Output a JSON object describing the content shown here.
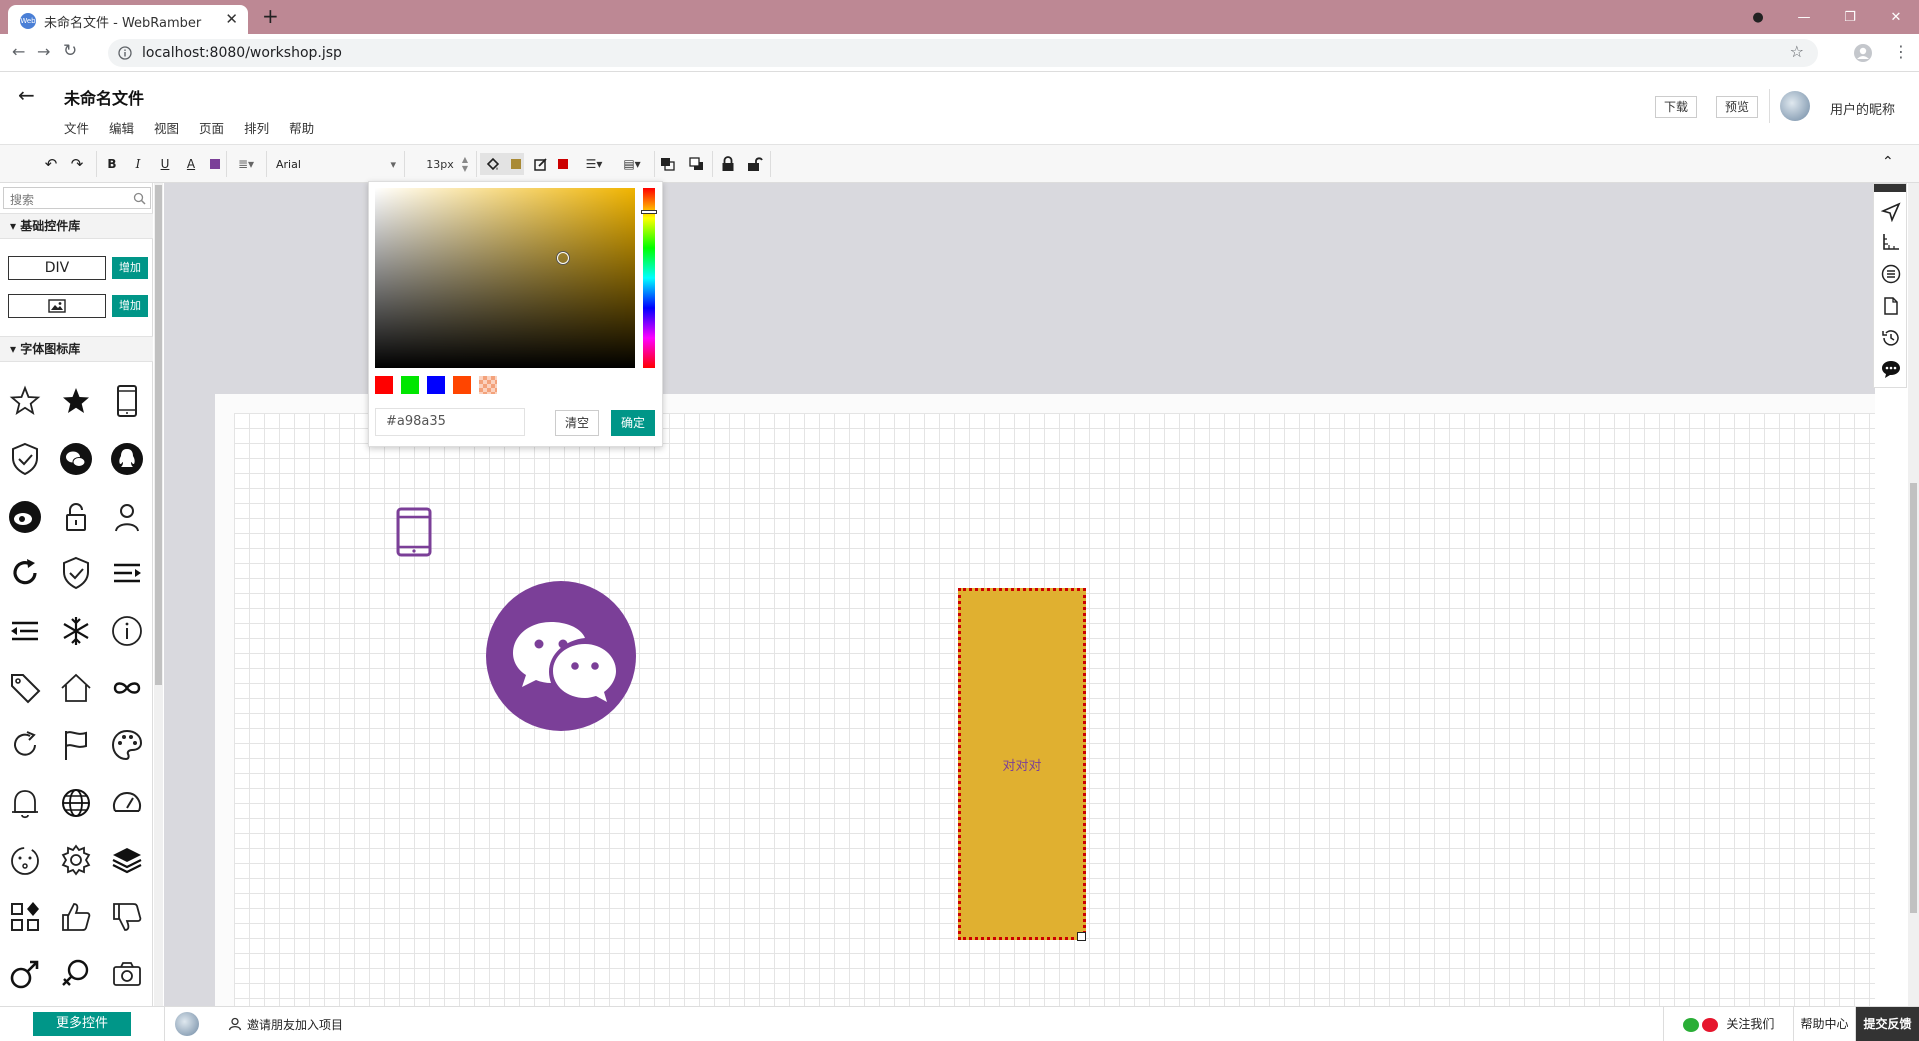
{
  "browser": {
    "tab_title": "未命名文件 - WebRamber",
    "favicon_text": "Web",
    "url": "localhost:8080/workshop.jsp"
  },
  "header": {
    "doc_title": "未命名文件",
    "menus": [
      "文件",
      "编辑",
      "视图",
      "页面",
      "排列",
      "帮助"
    ],
    "download_label": "下载",
    "preview_label": "预览",
    "nickname": "用户的昵称"
  },
  "toolbar": {
    "bold": "B",
    "italic": "I",
    "underline": "U",
    "font_color_glyph": "A",
    "font_family": "Arial",
    "font_size": "13px",
    "font_color": "#7b3f98",
    "fill_color": "#a98a35",
    "stroke_color": "#cc0000"
  },
  "sidebar": {
    "search_placeholder": "搜索",
    "basic_section": "基础控件库",
    "basic_items": [
      {
        "label": "DIV",
        "add": "增加"
      },
      {
        "label": "",
        "icon": "image-icon",
        "add": "增加"
      }
    ],
    "icon_section": "字体图标库",
    "icons": [
      "star-outline-icon",
      "star-filled-icon",
      "tablet-icon",
      "shield-check-icon",
      "wechat-icon",
      "qq-icon",
      "weibo-icon",
      "unlock-icon",
      "user-icon",
      "refresh-icon",
      "shield-check-icon",
      "indent-icon",
      "outdent-icon",
      "snowflake-icon",
      "info-icon",
      "tag-icon",
      "home-icon",
      "infinity-icon",
      "refresh-icon",
      "flag-icon",
      "palette-icon",
      "bell-icon",
      "globe-icon",
      "dashboard-icon",
      "face-icon",
      "gear-icon",
      "layers-icon",
      "apps-icon",
      "thumbs-up-icon",
      "thumbs-down-icon",
      "male-icon",
      "female-icon",
      "camera-icon"
    ]
  },
  "color_picker": {
    "hex_value": "#a98a35",
    "clear_label": "清空",
    "confirm_label": "确定",
    "swatches": [
      "#ff0000",
      "#00e600",
      "#0000ff",
      "#ff4500",
      "#f3a27b"
    ]
  },
  "canvas": {
    "text_box_label": "对对对",
    "text_box_fill": "#e0b030",
    "icon_color": "#7b3f98"
  },
  "footer": {
    "more_label": "更多控件",
    "invite_label": "邀请朋友加入项目",
    "follow_label": "关注我们",
    "help_label": "帮助中心",
    "feedback_label": "提交反馈"
  }
}
